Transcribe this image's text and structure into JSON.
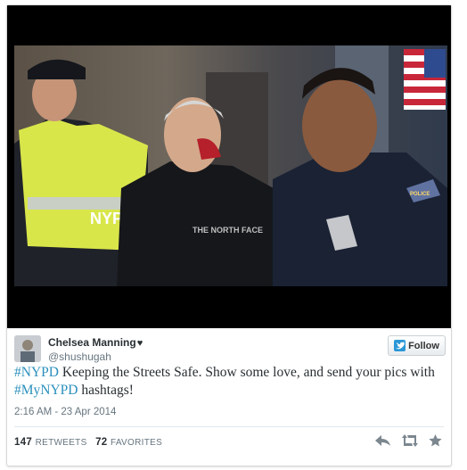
{
  "tweet": {
    "author_name": "Chelsea Manning",
    "author_heart": "♥",
    "author_handle": "@shushugah",
    "follow_label": "Follow",
    "text_parts": {
      "hashtag_1": "#NYPD",
      "body_1": " Keeping the Streets Safe. Show some love, and send your pics with ",
      "hashtag_2": "#MyNYPD",
      "body_2": " hashtags!"
    },
    "timestamp": "2:16 AM - 23 Apr 2014",
    "retweets_count": "147",
    "retweets_label": "RETWEETS",
    "favorites_count": "72",
    "favorites_label": "FAVORITES",
    "photo_texts": {
      "vest_label": "NYPD",
      "vest_label_2": "POLICE",
      "jacket_brand": "THE NORTH FACE"
    }
  },
  "icons": {
    "reply": "reply-icon",
    "retweet": "retweet-icon",
    "favorite": "star-icon",
    "follow_bird": "twitter-bird-icon"
  },
  "colors": {
    "hashtag": "#2a8fbd",
    "follow_bird_bg": "#2b97d6",
    "text": "#292f33",
    "muted": "#66757f"
  }
}
